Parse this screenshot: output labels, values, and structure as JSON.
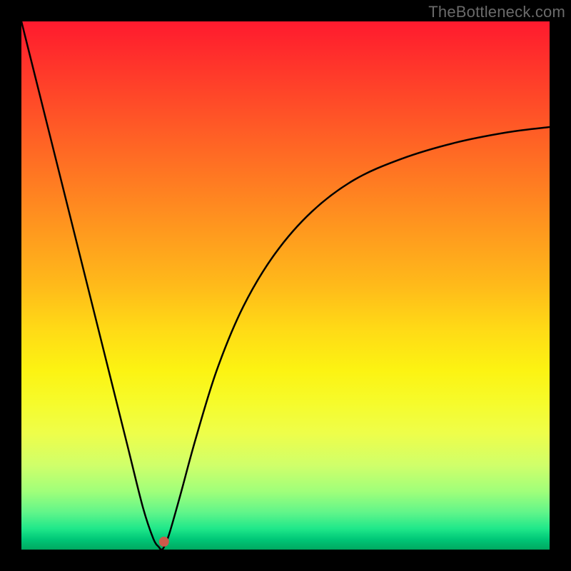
{
  "attribution": "TheBottleneck.com",
  "chart_data": {
    "type": "line",
    "title": "",
    "xlabel": "",
    "ylabel": "",
    "xlim": [
      0,
      100
    ],
    "ylim": [
      0,
      100
    ],
    "grid": false,
    "series": [
      {
        "name": "bottleneck-curve",
        "x": [
          0,
          5,
          10,
          15,
          20,
          23,
          25,
          26,
          26.5,
          27,
          28,
          30,
          33,
          37,
          42,
          48,
          55,
          63,
          72,
          82,
          92,
          100
        ],
        "values": [
          100,
          80,
          60,
          40,
          20,
          8,
          2,
          0.5,
          0.0,
          0.5,
          3,
          10,
          21,
          34,
          46,
          56,
          64,
          70,
          74,
          77,
          79,
          80
        ]
      }
    ],
    "marker": {
      "x": 27,
      "y": 1.5,
      "color": "#cc5a4a",
      "radius_px": 7
    }
  },
  "colors": {
    "curve": "#000000",
    "marker": "#cc5a4a",
    "frame": "#000000"
  }
}
